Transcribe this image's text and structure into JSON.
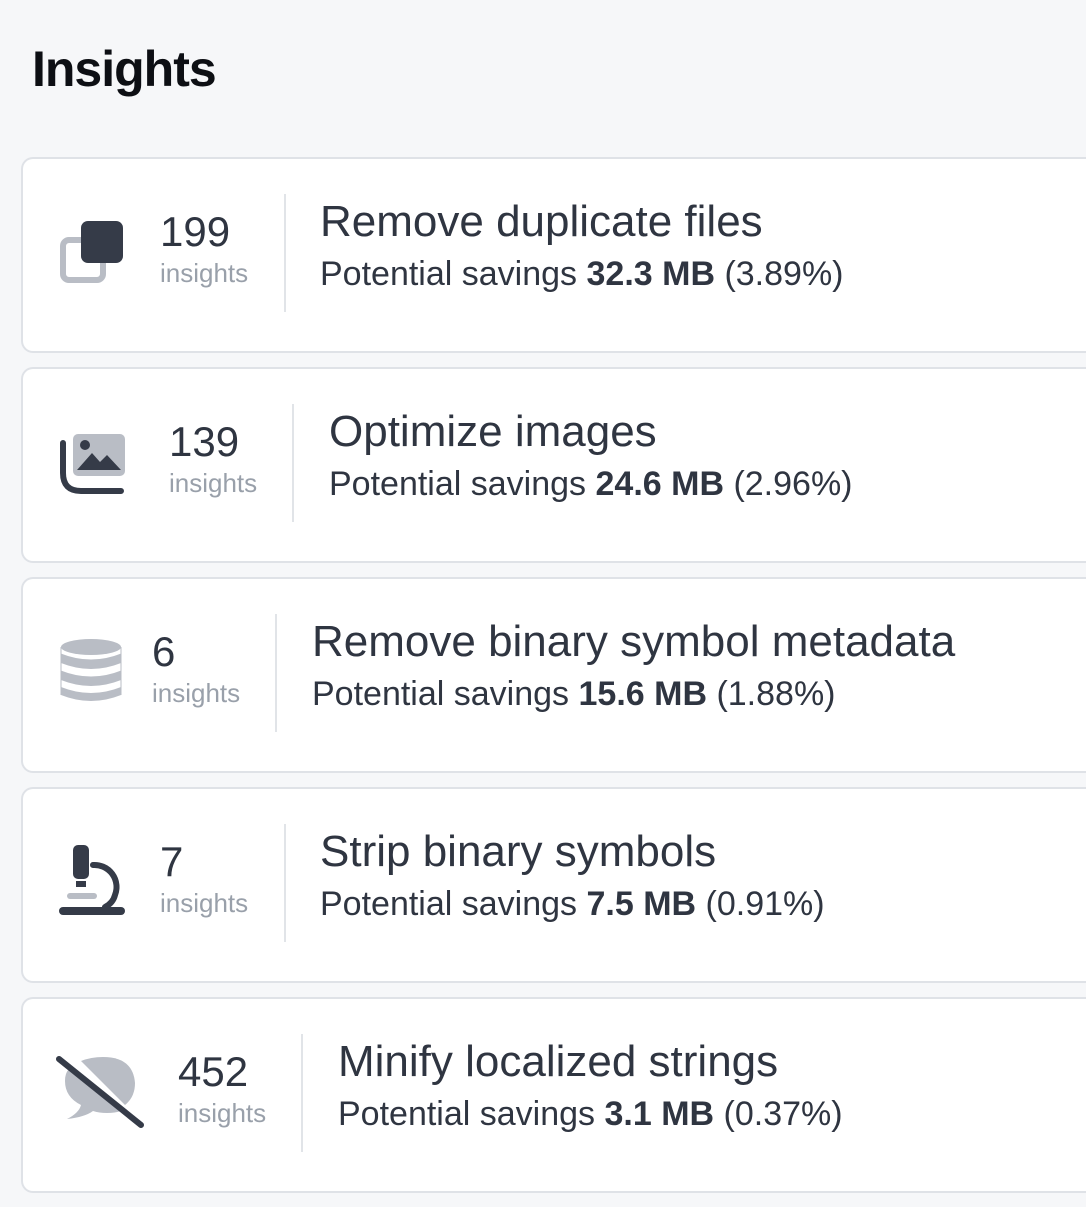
{
  "page_title": "Insights",
  "savings_prefix": "Potential savings",
  "insights": [
    {
      "icon": "duplicate-files-icon",
      "count": "199",
      "count_label": "insights",
      "title": "Remove duplicate files",
      "amount": "32.3 MB",
      "percent": "(3.89%)"
    },
    {
      "icon": "images-icon",
      "count": "139",
      "count_label": "insights",
      "title": "Optimize images",
      "amount": "24.6 MB",
      "percent": "(2.96%)"
    },
    {
      "icon": "database-icon",
      "count": "6",
      "count_label": "insights",
      "title": "Remove binary symbol metadata",
      "amount": "15.6 MB",
      "percent": "(1.88%)"
    },
    {
      "icon": "microscope-icon",
      "count": "7",
      "count_label": "insights",
      "title": "Strip binary symbols",
      "amount": "7.5 MB",
      "percent": "(0.91%)"
    },
    {
      "icon": "comment-slash-icon",
      "count": "452",
      "count_label": "insights",
      "title": "Minify localized strings",
      "amount": "3.1 MB",
      "percent": "(0.37%)"
    }
  ]
}
